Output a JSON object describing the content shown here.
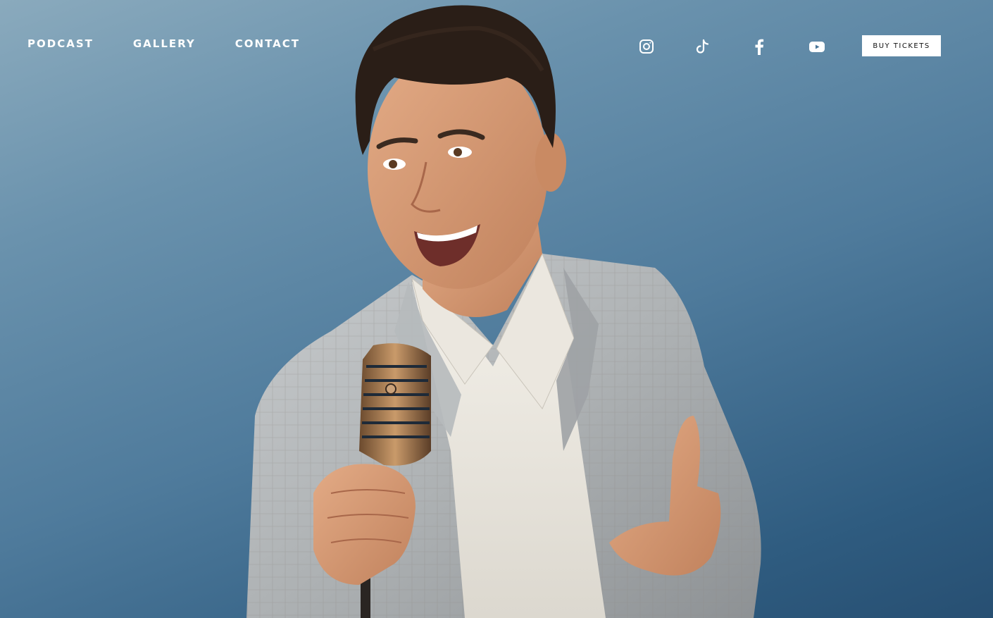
{
  "nav": {
    "items": [
      {
        "label": "PODCAST"
      },
      {
        "label": "GALLERY"
      },
      {
        "label": "CONTACT"
      }
    ]
  },
  "social": {
    "icons": [
      "instagram-icon",
      "tiktok-icon",
      "facebook-icon",
      "youtube-icon"
    ]
  },
  "header": {
    "cta_label": "BUY TICKETS"
  },
  "colors": {
    "background_top": "#8aaabd",
    "background_bottom": "#274f72",
    "nav_text": "#ffffff",
    "cta_background": "#ffffff",
    "cta_text": "#111111"
  }
}
